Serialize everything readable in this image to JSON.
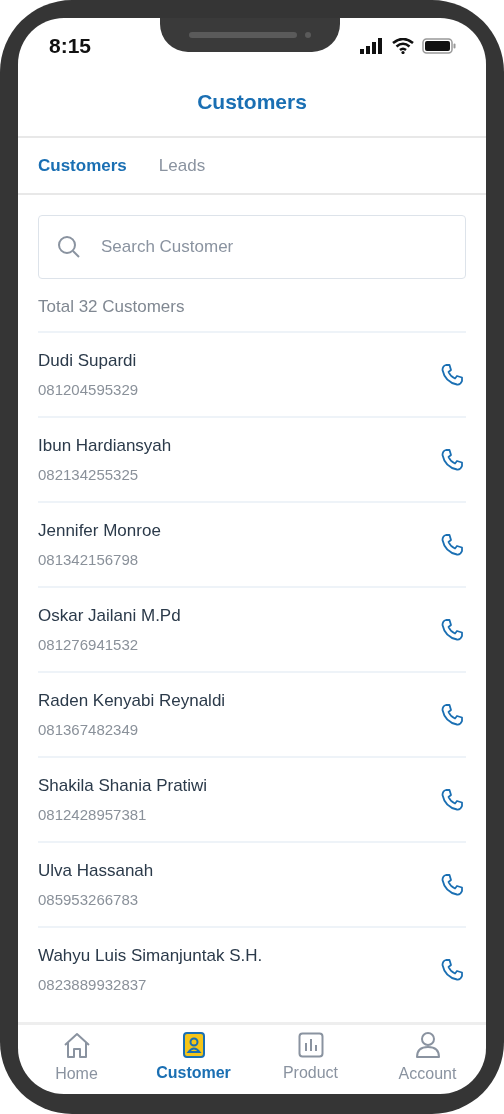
{
  "status_bar": {
    "time": "8:15"
  },
  "header": {
    "title": "Customers"
  },
  "tabs": [
    {
      "label": "Customers",
      "selected": true
    },
    {
      "label": "Leads",
      "selected": false
    }
  ],
  "search": {
    "placeholder": "Search Customer"
  },
  "total": "Total 32 Customers",
  "customers": [
    {
      "name": "Dudi Supardi",
      "phone": "081204595329"
    },
    {
      "name": "Ibun Hardiansyah",
      "phone": "082134255325"
    },
    {
      "name": "Jennifer Monroe",
      "phone": "081342156798"
    },
    {
      "name": "Oskar Jailani M.Pd",
      "phone": "081276941532"
    },
    {
      "name": "Raden Kenyabi Reynaldi",
      "phone": "081367482349"
    },
    {
      "name": "Shakila Shania Pratiwi",
      "phone": "0812428957381"
    },
    {
      "name": "Ulva Hassanah",
      "phone": "085953266783"
    },
    {
      "name": "Wahyu Luis Simanjuntak S.H.",
      "phone": "0823889932837"
    }
  ],
  "bottom_nav": [
    {
      "label": "Home",
      "selected": false
    },
    {
      "label": "Customer",
      "selected": true
    },
    {
      "label": "Product",
      "selected": false
    },
    {
      "label": "Account",
      "selected": false
    }
  ]
}
